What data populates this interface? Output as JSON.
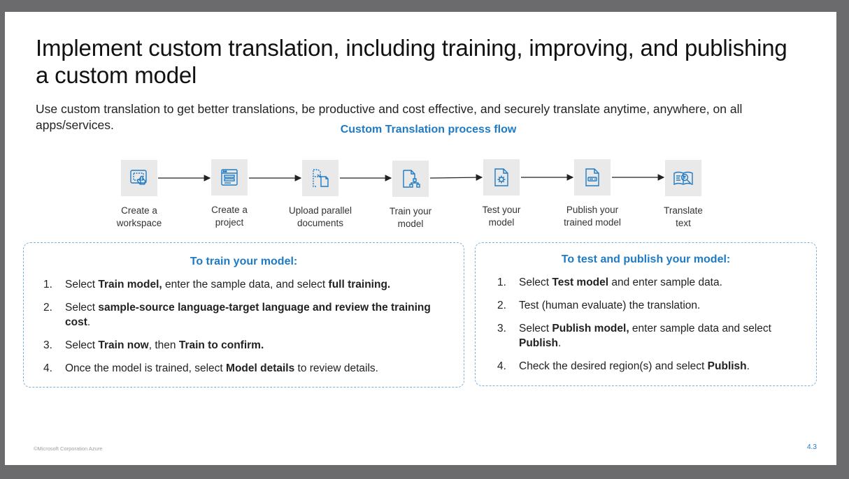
{
  "slide": {
    "title": "Implement custom translation, including training, improving, and publishing a custom model",
    "subtitle": "Use custom translation to get better translations, be productive and cost effective, and securely translate anytime, anywhere, on all apps/services.",
    "flow_heading": "Custom Translation process flow",
    "steps": [
      {
        "label": "Create a\nworkspace",
        "icon": "touch-screen-icon"
      },
      {
        "label": "Create a\nproject",
        "icon": "browser-window-icon"
      },
      {
        "label": "Upload parallel\ndocuments",
        "icon": "parallel-documents-icon"
      },
      {
        "label": "Train your\nmodel",
        "icon": "document-hierarchy-icon"
      },
      {
        "label": "Test your\nmodel",
        "icon": "document-gear-icon"
      },
      {
        "label": "Publish your\ntrained model",
        "icon": "document-key-icon"
      },
      {
        "label": "Translate\ntext",
        "icon": "book-search-icon"
      }
    ],
    "train_panel": {
      "title": "To train your model:",
      "items": [
        {
          "num": "1.",
          "parts": [
            {
              "t": "Select "
            },
            {
              "t": "Train model,",
              "b": true
            },
            {
              "t": " enter the sample data, and select "
            },
            {
              "t": "full training.",
              "b": true
            }
          ]
        },
        {
          "num": "2.",
          "parts": [
            {
              "t": "Select "
            },
            {
              "t": "sample-source language-target language and review the training cost",
              "b": true
            },
            {
              "t": "."
            }
          ]
        },
        {
          "num": "3.",
          "parts": [
            {
              "t": "Select "
            },
            {
              "t": "Train now",
              "b": true
            },
            {
              "t": ", then "
            },
            {
              "t": "Train to confirm.",
              "b": true
            }
          ]
        },
        {
          "num": "4.",
          "parts": [
            {
              "t": "Once the model is trained, select "
            },
            {
              "t": "Model details",
              "b": true
            },
            {
              "t": " to review details."
            }
          ]
        }
      ]
    },
    "publish_panel": {
      "title": "To test and publish your model:",
      "items": [
        {
          "num": "1.",
          "parts": [
            {
              "t": "Select "
            },
            {
              "t": "Test model",
              "b": true
            },
            {
              "t": " and enter sample data."
            }
          ]
        },
        {
          "num": "2.",
          "parts": [
            {
              "t": "Test (human evaluate) the translation."
            }
          ]
        },
        {
          "num": "3.",
          "parts": [
            {
              "t": "Select "
            },
            {
              "t": "Publish model,",
              "b": true
            },
            {
              "t": " enter sample data and select "
            },
            {
              "t": "Publish",
              "b": true
            },
            {
              "t": "."
            }
          ]
        },
        {
          "num": "4.",
          "parts": [
            {
              "t": "Check the desired region(s) and select "
            },
            {
              "t": "Publish",
              "b": true
            },
            {
              "t": "."
            }
          ]
        }
      ]
    },
    "footer": "©Microsoft Corporation Azure",
    "page_number": "4.3",
    "colors": {
      "accent": "#1f7ac4",
      "panel_border": "#7fb2db",
      "icon_tile": "#e9e9e9"
    }
  }
}
